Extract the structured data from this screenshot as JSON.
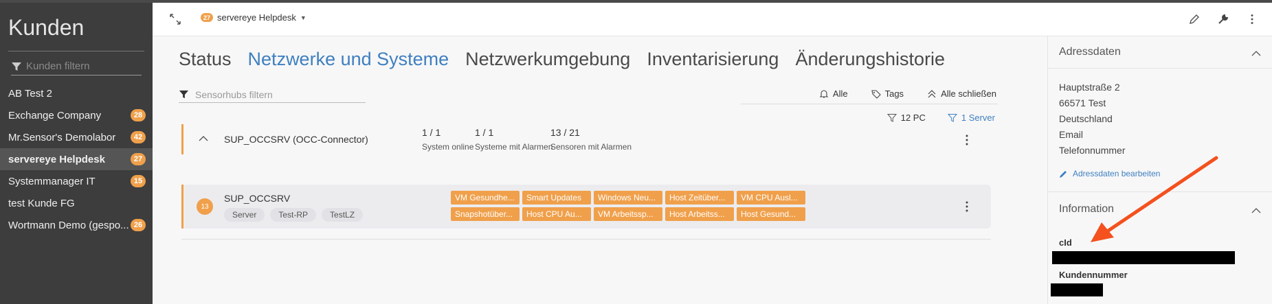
{
  "sidebar": {
    "title": "Kunden",
    "filter_placeholder": "Kunden filtern",
    "items": [
      {
        "label": "AB Test 2",
        "badge": ""
      },
      {
        "label": "Exchange Company",
        "badge": "28"
      },
      {
        "label": "Mr.Sensor's Demolabor",
        "badge": "42"
      },
      {
        "label": "servereye Helpdesk",
        "badge": "27",
        "active": true
      },
      {
        "label": "Systemmanager IT",
        "badge": "15"
      },
      {
        "label": "test Kunde FG",
        "badge": ""
      },
      {
        "label": "Wortmann Demo (gespo...",
        "badge": "26"
      }
    ]
  },
  "topbar": {
    "company_badge": "27",
    "company_name": "servereye Helpdesk"
  },
  "tabs": [
    "Status",
    "Netzwerke und Systeme",
    "Netzwerkumgebung",
    "Inventarisierung",
    "Änderungshistorie"
  ],
  "sensorhub_filter_placeholder": "Sensorhubs filtern",
  "toolbar": {
    "all": "Alle",
    "tags": "Tags",
    "close_all": "Alle schließen"
  },
  "type_filters": {
    "pc": "12 PC",
    "server": "1 Server"
  },
  "group": {
    "name": "SUP_OCCSRV (OCC-Connector)",
    "stats": [
      {
        "value": "1 / 1",
        "label": "System online"
      },
      {
        "value": "1 / 1",
        "label": "Systeme mit Alarmen"
      },
      {
        "value": "13 / 21",
        "label": "Sensoren mit Alarmen"
      }
    ]
  },
  "system": {
    "alarm_count": "13",
    "name": "SUP_OCCSRV",
    "tags": [
      "Server",
      "Test-RP",
      "TestLZ"
    ],
    "alarms": [
      "VM Gesundhe...",
      "Smart Updates",
      "Windows Neu...",
      "Host Zeitüber...",
      "VM CPU Ausl...",
      "Snapshotüber...",
      "Host CPU Au...",
      "VM Arbeitssp...",
      "Host Arbeitss...",
      "Host Gesund..."
    ]
  },
  "right_panel": {
    "address_title": "Adressdaten",
    "address_lines": [
      "Hauptstraße 2",
      "66571 Test",
      "Deutschland",
      "Email",
      "Telefonnummer"
    ],
    "edit_link": "Adressdaten bearbeiten",
    "info_title": "Information",
    "cid_label": "cId",
    "customer_number_label": "Kundennummer"
  },
  "colors": {
    "accent_orange": "#f0a04b",
    "link_blue": "#3f7fbf",
    "annotation_arrow": "#f4511e"
  }
}
